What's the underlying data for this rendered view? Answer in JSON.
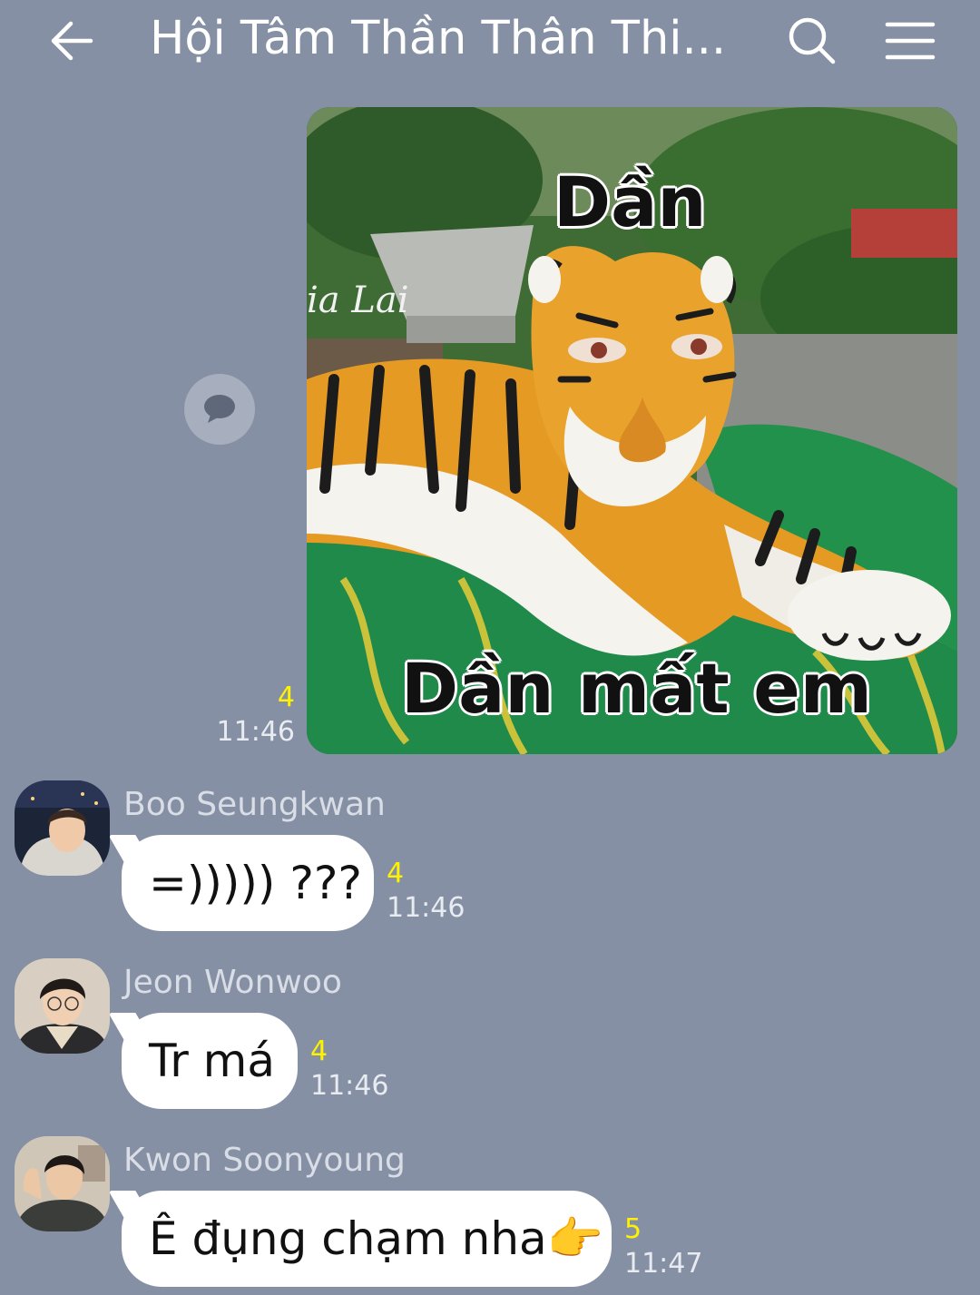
{
  "header": {
    "title": "Hội Tâm Thần Thân Thi...",
    "back_icon": "arrow-left-icon",
    "search_icon": "search-icon",
    "menu_icon": "hamburger-menu-icon"
  },
  "colors": {
    "background": "#8590a5",
    "bubble": "#ffffff",
    "read_count": "#fff200",
    "time": "#e8ebf0",
    "sender": "#d9dde6"
  },
  "messages": [
    {
      "type": "image",
      "direction": "outgoing",
      "image": {
        "caption_top": "Dần",
        "caption_bottom": "Dần mất em",
        "watermark": "ia Lai"
      },
      "read_count": "4",
      "time": "11:46",
      "share_icon": "chat-bubble-icon"
    },
    {
      "type": "text",
      "direction": "incoming",
      "sender": "Boo Seungkwan",
      "text": "=))))) ???",
      "read_count": "4",
      "time": "11:46"
    },
    {
      "type": "text",
      "direction": "incoming",
      "sender": "Jeon Wonwoo",
      "text": "Tr má",
      "read_count": "4",
      "time": "11:46"
    },
    {
      "type": "text",
      "direction": "incoming",
      "sender": "Kwon Soonyoung",
      "text": "Ê đụng chạm nha👉",
      "read_count": "5",
      "time": "11:47"
    }
  ]
}
